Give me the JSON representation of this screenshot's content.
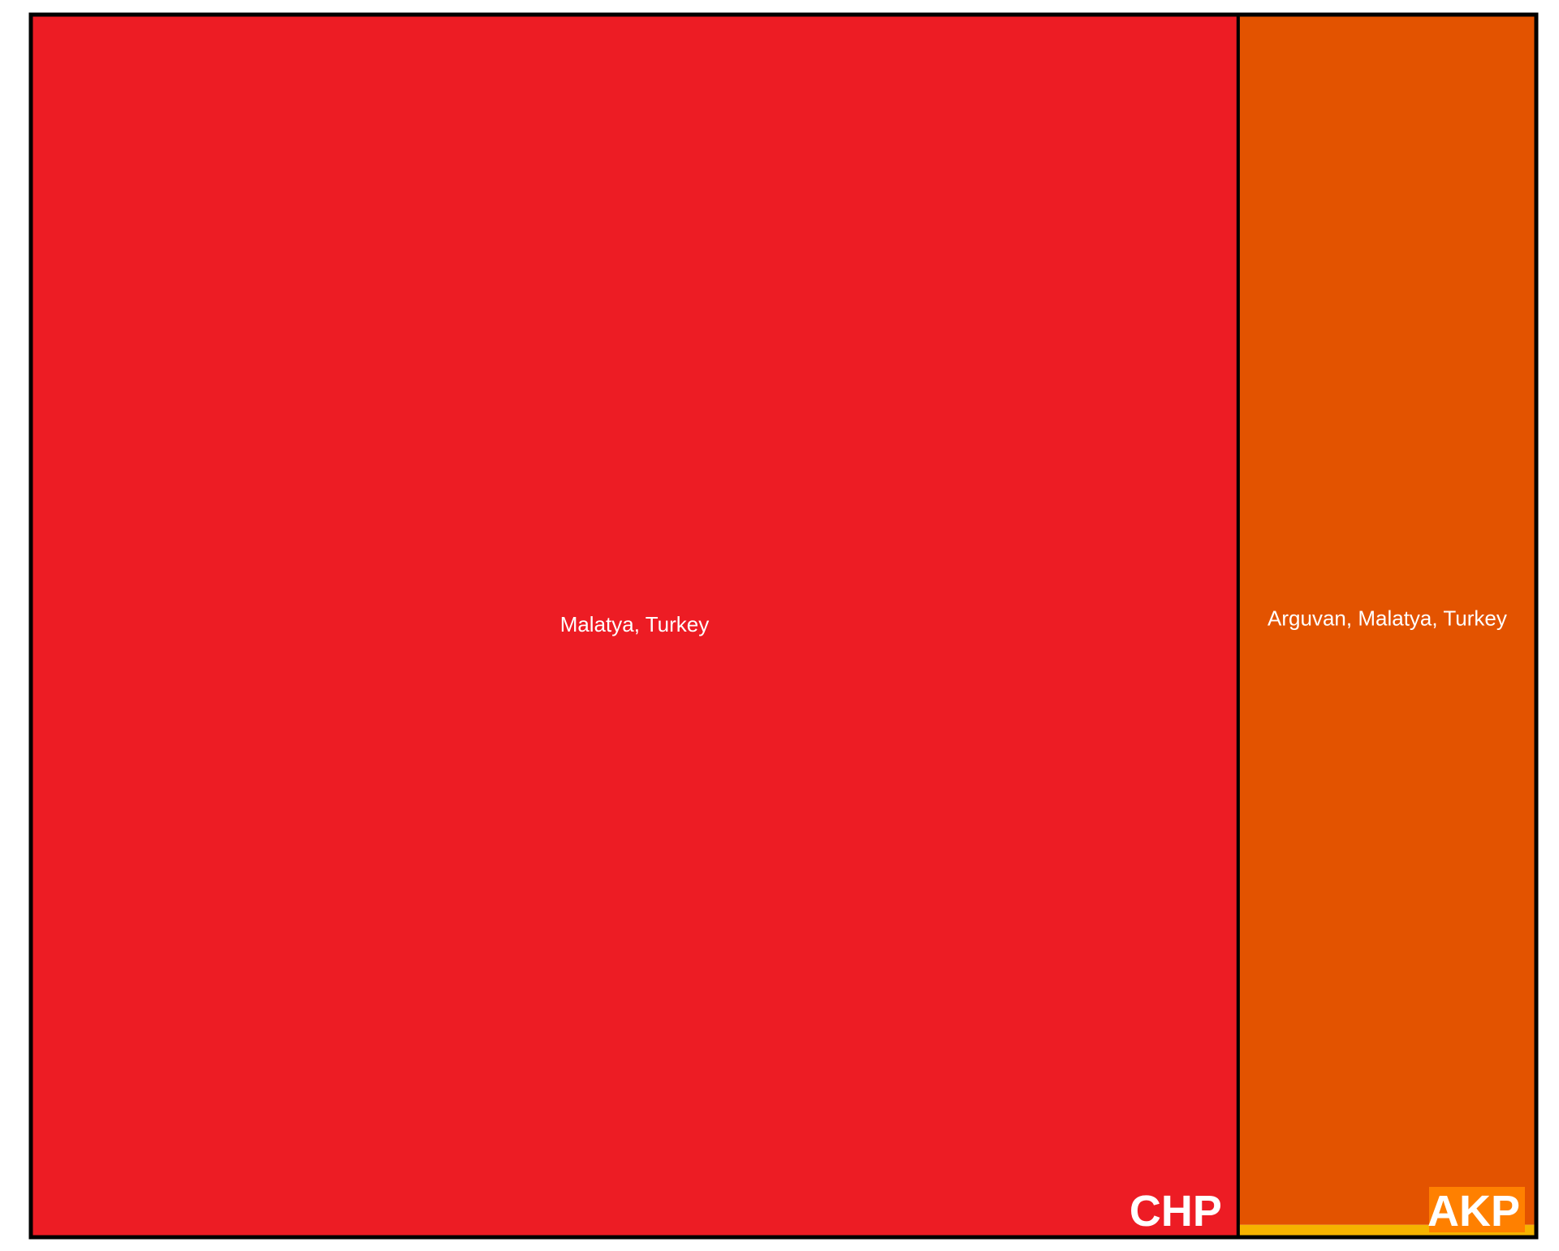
{
  "chart_data": {
    "type": "treemap",
    "groups": [
      {
        "label": "CHP",
        "color": "#ED1C24",
        "items": [
          {
            "label": "Malatya, Turkey",
            "value": 80.2,
            "color": "#ED1C24"
          }
        ]
      },
      {
        "label": "AKP",
        "color": "#FF8000",
        "items": [
          {
            "label": "Arguvan, Malatya, Turkey",
            "value": 19.6,
            "color": "#E35300"
          },
          {
            "label": "",
            "value": 0.2,
            "color": "#F6B300"
          }
        ]
      }
    ]
  }
}
